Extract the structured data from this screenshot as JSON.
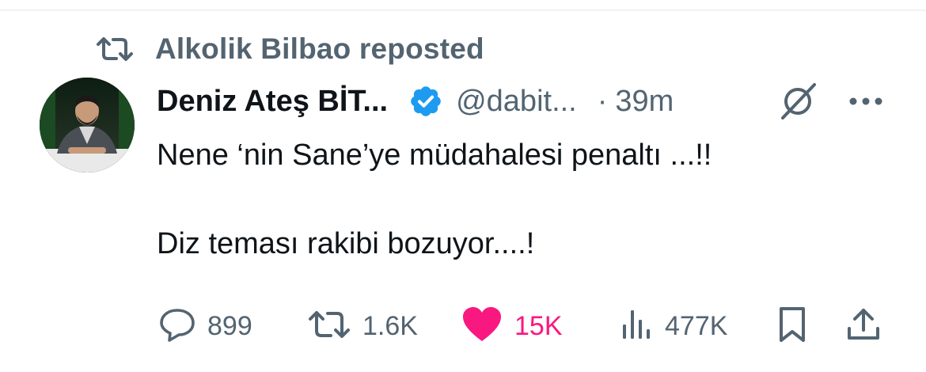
{
  "repost": {
    "label": "Alkolik Bilbao reposted",
    "icon": "repost-icon"
  },
  "author": {
    "display_name": "Deniz Ateş BİT...",
    "handle": "@dabit...",
    "separator": "·",
    "time": "39m",
    "verified": true,
    "avatar": "avatar-photo"
  },
  "tweet": {
    "paragraphs": [
      "Nene ‘nin Sane’ye müdahalesi penaltı ...!!",
      "",
      "Diz teması rakibi bozuyor....!"
    ]
  },
  "actions": {
    "replies": "899",
    "reposts": "1.6K",
    "likes": "15K",
    "views": "477K"
  },
  "colors": {
    "text": "#0f1419",
    "secondary": "#536471",
    "verified": "#1d9bf0",
    "like": "#f91880"
  }
}
